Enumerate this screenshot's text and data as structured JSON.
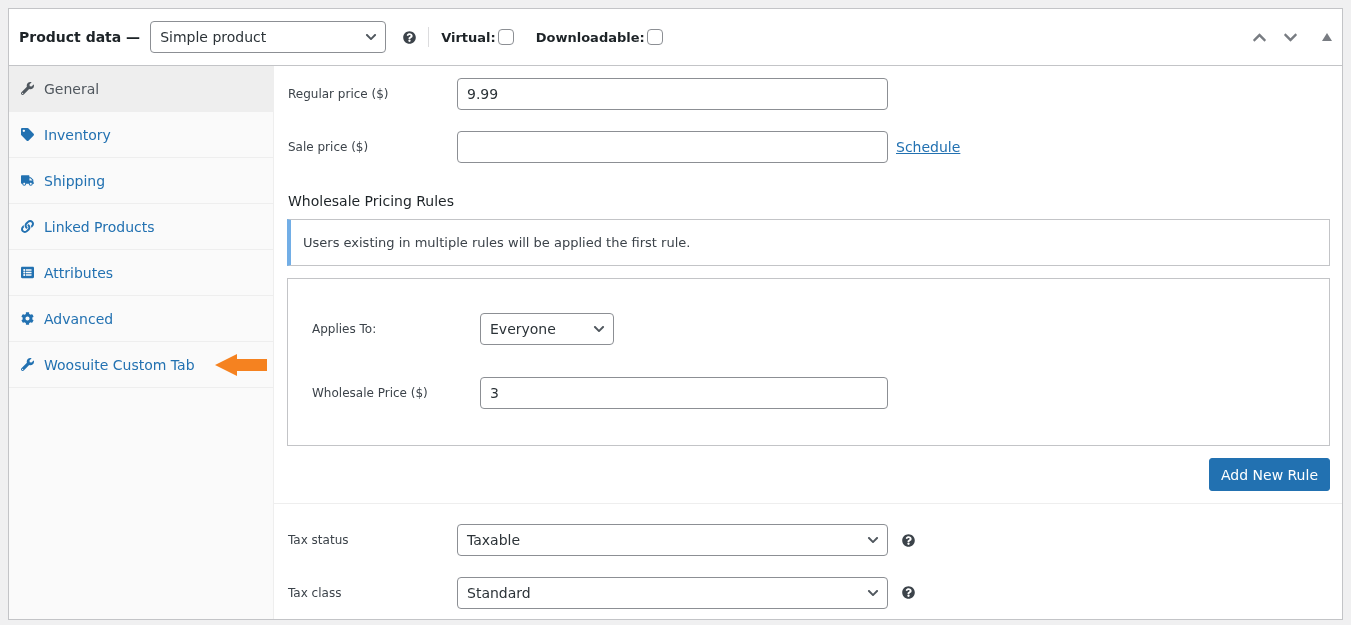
{
  "header": {
    "title": "Product data —",
    "product_type": "Simple product",
    "options": [
      {
        "label": "Virtual:",
        "checked": false
      },
      {
        "label": "Downloadable:",
        "checked": false
      }
    ]
  },
  "tabs": [
    {
      "label": "General",
      "selected": true,
      "pointed_at": false
    },
    {
      "label": "Inventory",
      "selected": false,
      "pointed_at": false
    },
    {
      "label": "Shipping",
      "selected": false,
      "pointed_at": false
    },
    {
      "label": "Linked Products",
      "selected": false,
      "pointed_at": false
    },
    {
      "label": "Attributes",
      "selected": false,
      "pointed_at": false
    },
    {
      "label": "Advanced",
      "selected": false,
      "pointed_at": false
    },
    {
      "label": "Woosuite Custom Tab",
      "selected": false,
      "pointed_at": true
    }
  ],
  "pricing": {
    "regular_label": "Regular price ($)",
    "regular_value": "9.99",
    "sale_label": "Sale price ($)",
    "schedule_link": "Schedule"
  },
  "wholesale": {
    "heading": "Wholesale Pricing Rules",
    "notice": "Users existing in multiple rules will be applied the first rule.",
    "applies_label": "Applies To:",
    "applies_value": "Everyone",
    "price_label": "Wholesale Price ($)",
    "price_value": "3",
    "add_button": "Add New Rule"
  },
  "tax": [
    {
      "label": "Tax status",
      "value": "Taxable"
    },
    {
      "label": "Tax class",
      "value": "Standard"
    }
  ]
}
